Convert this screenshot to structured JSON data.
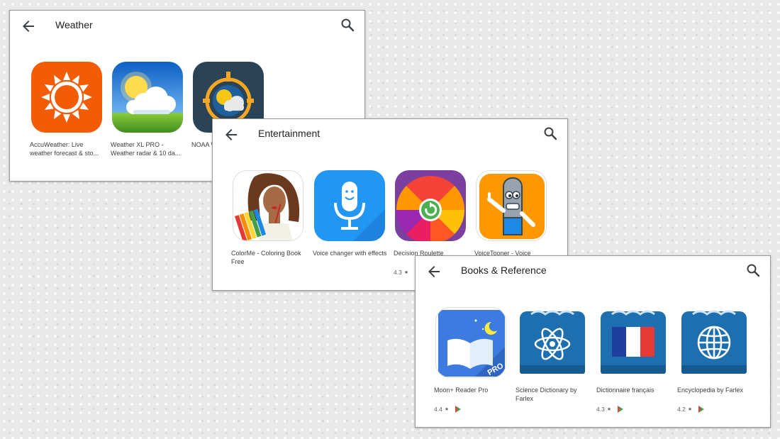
{
  "panels": {
    "weather": {
      "title": "Weather",
      "apps": [
        {
          "name": "AccuWeather: Live weather forecast & sto...",
          "icon": "accuweather-sun-icon"
        },
        {
          "name": "Weather XL PRO - Weather radar & 10 da...",
          "icon": "weather-xl-sun-cloud-icon"
        },
        {
          "name": "NOAA W... Internat...",
          "icon": "noaa-weather-icon"
        }
      ]
    },
    "entertainment": {
      "title": "Entertainment",
      "apps": [
        {
          "name": "ColorMe - Coloring Book Free",
          "icon": "colorme-icon"
        },
        {
          "name": "Voice changer with effects",
          "icon": "microphone-icon"
        },
        {
          "name": "Decision Roulette",
          "rating": "4.3",
          "star": "★",
          "icon": "roulette-wheel-icon"
        },
        {
          "name": "VoiceTooner - Voice",
          "icon": "voicetooner-robot-icon"
        }
      ]
    },
    "books": {
      "title": "Books & Reference",
      "apps": [
        {
          "name": "Moon+ Reader Pro",
          "rating": "4.4",
          "star": "★",
          "icon": "moon-reader-book-icon",
          "badge": "PRO"
        },
        {
          "name": "Science Dictionary by Farlex",
          "icon": "atom-book-icon"
        },
        {
          "name": "Dictionnaire français",
          "rating": "4.3",
          "star": "★",
          "icon": "french-flag-book-icon"
        },
        {
          "name": "Encyclopedia by Farlex",
          "rating": "4.2",
          "star": "★",
          "icon": "globe-book-icon"
        }
      ]
    }
  },
  "colors": {
    "accuweather": "#f25c05",
    "microphone_bg": "#2196f3",
    "farlex_blue": "#1e6fb0",
    "moon_blue": "#3d7be0"
  }
}
